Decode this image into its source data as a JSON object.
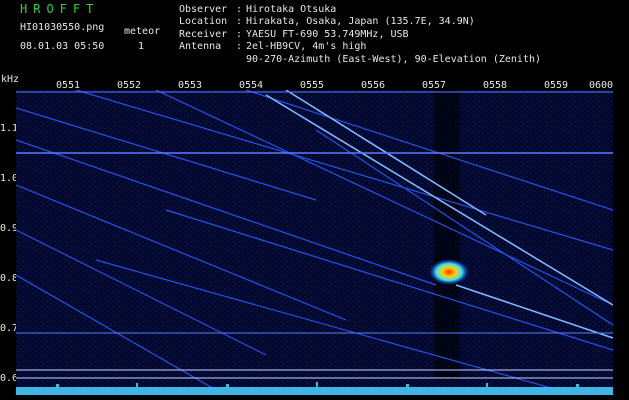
{
  "header": {
    "brand": "HROFFT",
    "filename": "HI01030550.png",
    "datetime": "08.01.03 05:50",
    "meteor_label": "meteor",
    "meteor_count": "1",
    "info": [
      {
        "key": "Observer",
        "value": "Hirotaka Otsuka"
      },
      {
        "key": "Location",
        "value": "Hirakata, Osaka, Japan (135.7E, 34.9N)"
      },
      {
        "key": "Receiver",
        "value": "YAESU FT-690 53.749MHz, USB"
      },
      {
        "key": "Antenna",
        "value": "2el-HB9CV, 4m's high"
      }
    ],
    "antenna_line2": "90-270-Azimuth (East-West), 90-Elevation (Zenith)"
  },
  "axis": {
    "y_unit": "kHz",
    "y_ticks": [
      "1.1",
      "1.0",
      "0.9",
      "0.8",
      "0.7",
      "0.6"
    ],
    "x_ticks": [
      "0551",
      "0552",
      "0553",
      "0554",
      "0555",
      "0556",
      "0557",
      "0558",
      "0559",
      "0600"
    ]
  },
  "colors": {
    "background": "#000000",
    "spectrum_bg": "#000a3a",
    "trace": "#3b7bff",
    "trace_bright": "#9ed0ff",
    "text": "#e6e6e6",
    "brand": "#29d629",
    "noise": "#3fb6e6"
  }
}
